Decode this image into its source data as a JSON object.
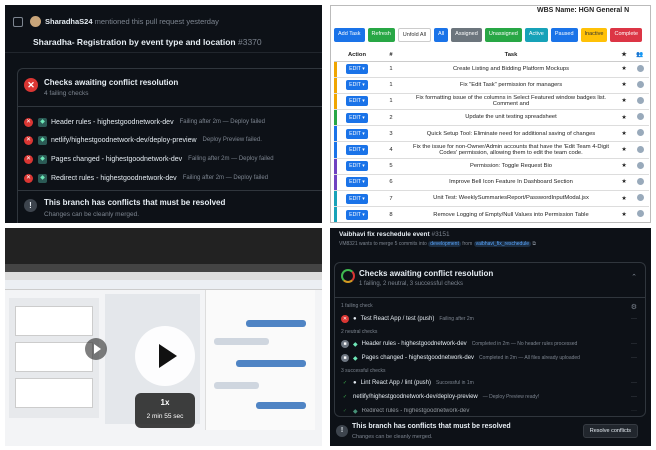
{
  "pr_panel": {
    "author": "SharadhaS24",
    "mention_text": "mentioned this pull request yesterday",
    "title": "Sharadha- Registration by event type and location",
    "pr_number": "#3370",
    "checks_header": "Checks awaiting conflict resolution",
    "checks_sub": "4 failing checks",
    "checks": [
      {
        "name": "Header rules - highestgoodnetwork-dev",
        "status": "Failing after 2m — Deploy failed"
      },
      {
        "name": "netlify/highestgoodnetwork-dev/deploy-preview",
        "status": "Deploy Preview failed."
      },
      {
        "name": "Pages changed - highestgoodnetwork-dev",
        "status": "Failing after 2m — Deploy failed"
      },
      {
        "name": "Redirect rules - highestgoodnetwork-dev",
        "status": "Failing after 2m — Deploy failed"
      }
    ],
    "conflict_title": "This branch has conflicts that must be resolved",
    "conflict_sub": "Changes can be cleanly merged."
  },
  "task_panel": {
    "wbs_title": "WBS Name: HGN General N",
    "buttons": [
      {
        "label": "Add Task",
        "color": "#1a73e8"
      },
      {
        "label": "Refresh",
        "color": "#28a745"
      },
      {
        "label": "Unfold All",
        "color": "#ffffff"
      },
      {
        "label": "All",
        "color": "#1a73e8"
      },
      {
        "label": "Assigned",
        "color": "#6c757d"
      },
      {
        "label": "Unassigned",
        "color": "#28a745"
      },
      {
        "label": "Active",
        "color": "#17a2b8"
      },
      {
        "label": "Paused",
        "color": "#1a73e8"
      },
      {
        "label": "Inactive",
        "color": "#ffc107"
      },
      {
        "label": "Complete",
        "color": "#dc3545"
      }
    ],
    "columns": [
      "Action",
      "#",
      "Task",
      "★",
      "👥"
    ],
    "edit_label": "EDIT ▾",
    "rows": [
      {
        "num": "1",
        "task": "Create Listing and Bidding Platform Mockups",
        "color": "#f0a500"
      },
      {
        "num": "1",
        "task": "Fix \"Edit Task\" permission for managers",
        "color": "#f0a500"
      },
      {
        "num": "1",
        "task": "Fix formatting issue of the columns in Select Featured window badges list. Comment and",
        "color": "#f0a500"
      },
      {
        "num": "2",
        "task": "Update the unit testing spreadsheet",
        "color": "#28a745"
      },
      {
        "num": "3",
        "task": "Quick Setup Tool: Eliminate need for additional saving of changes",
        "color": "#1a73e8"
      },
      {
        "num": "4",
        "task": "Fix the issue for non-Owner/Admin accounts that have the 'Edit Team 4-Digit Codes' permission, allowing them to edit the team code.",
        "color": "#1a73e8"
      },
      {
        "num": "5",
        "task": "Permission: Toggle Request Bio",
        "color": "#6f42c1"
      },
      {
        "num": "6",
        "task": "Improve Bell Icon Feature In Dashboard Section",
        "color": "#6f42c1"
      },
      {
        "num": "7",
        "task": "Unit Test: WeeklySummariesReport/PasswordInputModal.jsx",
        "color": "#17a2b8"
      },
      {
        "num": "8",
        "task": "Remove Logging of Empty/Null Values into Permission Table",
        "color": "#17a2b8"
      }
    ]
  },
  "video_panel": {
    "speed": "1x",
    "duration": "2 min 55 sec"
  },
  "checks_panel": {
    "author": "Vaibhavi fix reschedule event",
    "pr_number": "#3151",
    "merge_text": "VM8321 wants to merge 5 commits into",
    "base_branch": "development",
    "from_text": "from",
    "head_branch": "vaibhavi_fix_reschedule",
    "header": "Checks awaiting conflict resolution",
    "sub": "1 failing, 2 neutral, 3 successful checks",
    "sections": {
      "failing": "1 failing check",
      "neutral": "2 neutral checks",
      "successful": "3 successful checks"
    },
    "checks": [
      {
        "name": "Test React App / test (push)",
        "status": "Failing after 2m",
        "state": "fail"
      },
      {
        "name": "Header rules - highestgoodnetwork-dev",
        "status": "Completed in 2m — No header rules processed",
        "state": "neutral"
      },
      {
        "name": "Pages changed - highestgoodnetwork-dev",
        "status": "Completed in 2m — All files already uploaded",
        "state": "neutral"
      },
      {
        "name": "Lint React App / lint (push)",
        "status": "Successful in 1m",
        "state": "pass"
      },
      {
        "name": "netlify/highestgoodnetwork-dev/deploy-preview",
        "status": "— Deploy Preview ready!",
        "state": "pass"
      },
      {
        "name": "Redirect rules - highestgoodnetwork-dev",
        "status": "",
        "state": "pass"
      }
    ],
    "conflict_title": "This branch has conflicts that must be resolved",
    "conflict_sub": "Changes can be cleanly merged.",
    "resolve_label": "Resolve conflicts"
  }
}
